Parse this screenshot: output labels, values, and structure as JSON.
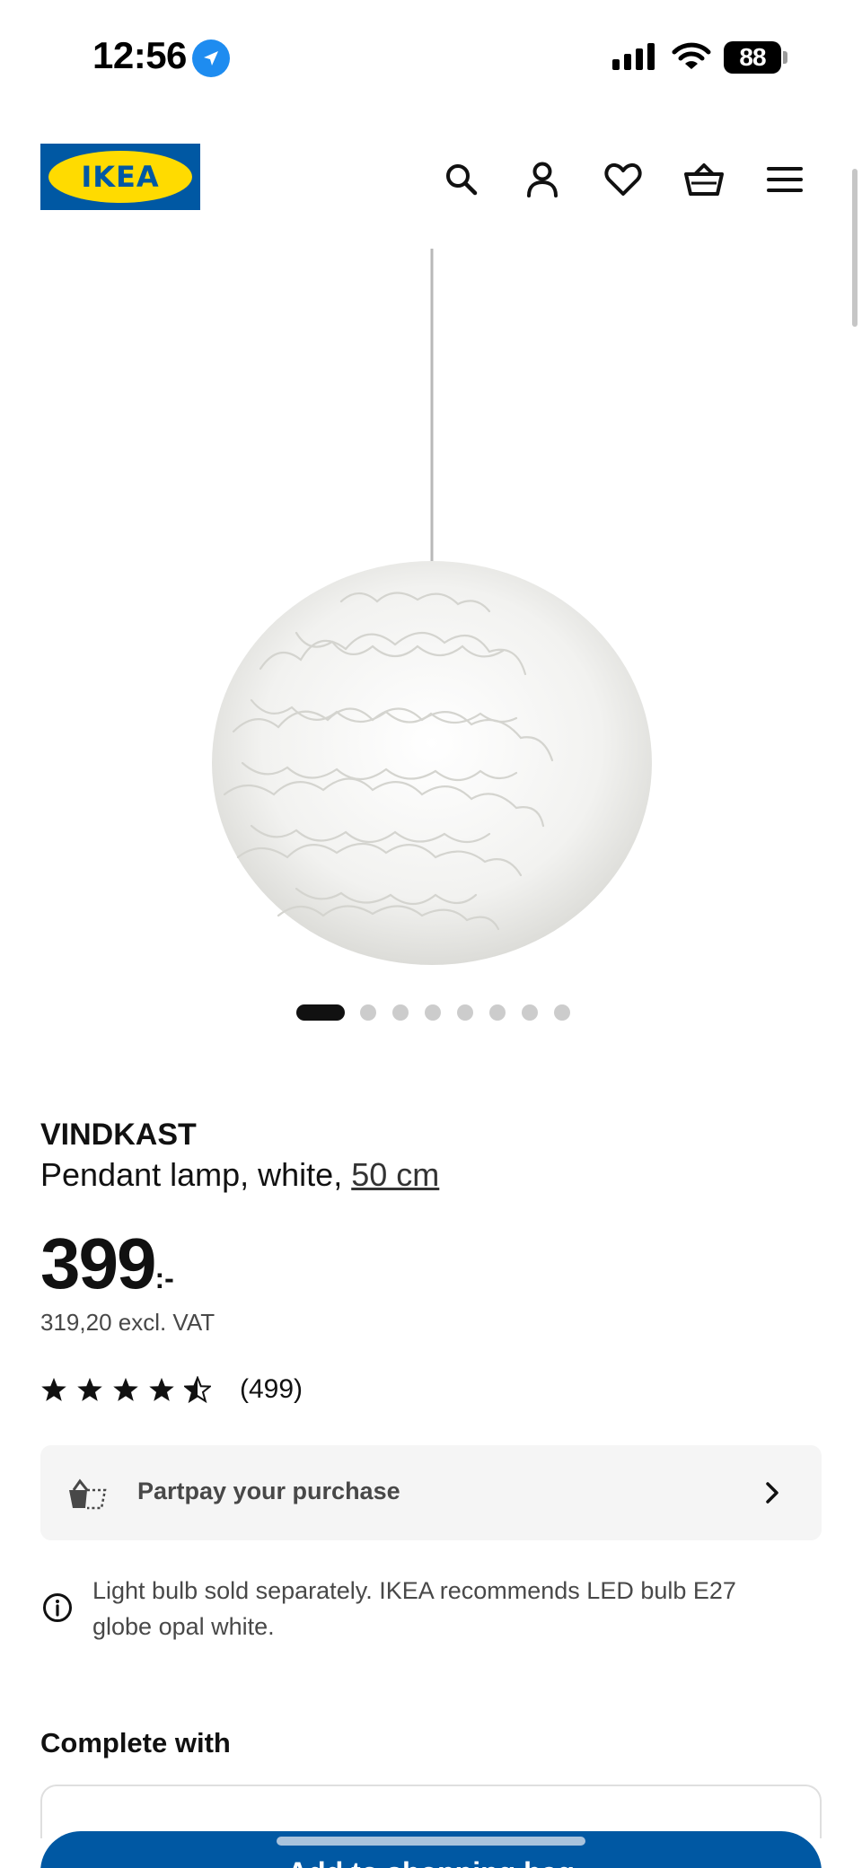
{
  "status_bar": {
    "time": "12:56",
    "battery": "88",
    "icons": [
      "location-arrow-icon",
      "signal-icon",
      "wifi-icon",
      "battery-icon"
    ]
  },
  "header": {
    "logo_text": "IKEA",
    "icons": [
      "search-icon",
      "profile-icon",
      "heart-icon",
      "cart-icon",
      "menu-icon"
    ],
    "colors": {
      "brand_blue": "#0058a3",
      "brand_yellow": "#ffdb00"
    }
  },
  "gallery": {
    "image": "pendant-lamp-white-ruffled-globe",
    "dot_count": 8,
    "active_index": 0
  },
  "product": {
    "name": "VINDKAST",
    "description": "Pendant lamp, white,",
    "size": "50 cm",
    "price": "399",
    "price_suffix": ":-",
    "price_excl_vat": "319,20 excl. VAT",
    "rating_stars": 4.5,
    "review_count": "(499)"
  },
  "partpay": {
    "label": "Partpay your purchase",
    "icon": "partpay-basket-icon"
  },
  "info": {
    "text": "Light bulb sold separately. IKEA recommends LED bulb E27 globe opal white."
  },
  "complete_with": {
    "title": "Complete with"
  },
  "cta": {
    "label": "Add to shopping bag"
  }
}
